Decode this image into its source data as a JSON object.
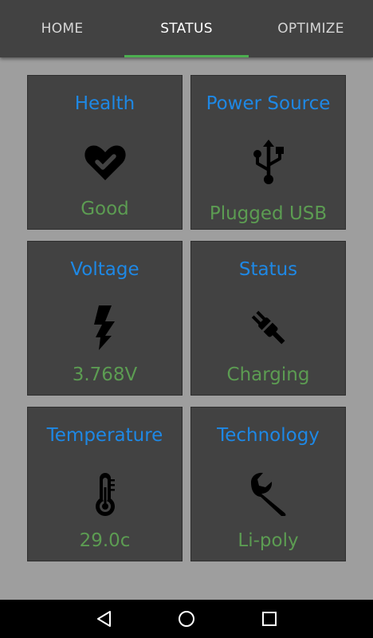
{
  "tabs": [
    {
      "label": "HOME",
      "active": false
    },
    {
      "label": "STATUS",
      "active": true
    },
    {
      "label": "OPTIMIZE",
      "active": false
    }
  ],
  "cards": [
    {
      "title": "Health",
      "icon": "heart-check-icon",
      "value": "Good"
    },
    {
      "title": "Power Source",
      "icon": "usb-icon",
      "value": "Plugged USB"
    },
    {
      "title": "Voltage",
      "icon": "lightning-bolt-icon",
      "value": "3.768V"
    },
    {
      "title": "Status",
      "icon": "plug-icon",
      "value": "Charging"
    },
    {
      "title": "Temperature",
      "icon": "thermometer-icon",
      "value": "29.0c"
    },
    {
      "title": "Technology",
      "icon": "wrench-icon",
      "value": "Li-poly"
    }
  ],
  "navigation": [
    {
      "icon": "back-icon"
    },
    {
      "icon": "home-icon"
    },
    {
      "icon": "recents-icon"
    }
  ],
  "colors": {
    "title": "#1e88e5",
    "value": "#5c9c52",
    "card_bg": "#424242",
    "page_bg": "#9e9e9e",
    "tab_indicator": "#4caf50"
  }
}
